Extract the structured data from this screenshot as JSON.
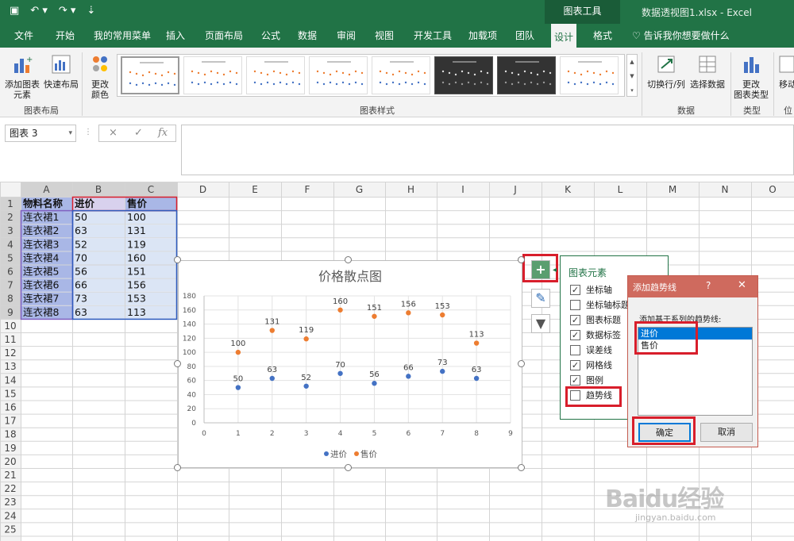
{
  "window": {
    "title": "数据透视图1.xlsx - Excel",
    "context_tab_group": "图表工具",
    "qat": {
      "save_icon": "save-icon",
      "undo_icon": "undo-icon",
      "redo_icon": "redo-icon"
    }
  },
  "tabs": [
    "文件",
    "开始",
    "我的常用菜单",
    "插入",
    "页面布局",
    "公式",
    "数据",
    "审阅",
    "视图",
    "开发工具",
    "加载项",
    "团队",
    "设计",
    "格式"
  ],
  "active_tab": "设计",
  "tell_me": "告诉我你想要做什么",
  "ribbon": {
    "add_element": "添加图表\n元素",
    "quick_layout": "快速布局",
    "change_color": "更改\n颜色",
    "group_layout": "图表布局",
    "group_styles": "图表样式",
    "switch_row_col": "切换行/列",
    "select_data": "选择数据",
    "group_data": "数据",
    "change_type": "更改\n图表类型",
    "group_type": "类型",
    "move": "移动",
    "group_location": "位"
  },
  "formula_bar": {
    "name_box": "图表 3",
    "cancel": "×",
    "enter": "✓",
    "fx": "fx",
    "formula": ""
  },
  "sheet": {
    "columns": [
      "A",
      "B",
      "C",
      "D",
      "E",
      "F",
      "G",
      "H",
      "I",
      "J",
      "K",
      "L",
      "M",
      "N",
      "O"
    ],
    "rows": [
      [
        "物料名称",
        "进价",
        "售价"
      ],
      [
        "连衣裙1",
        "50",
        "100"
      ],
      [
        "连衣裙2",
        "63",
        "131"
      ],
      [
        "连衣裙3",
        "52",
        "119"
      ],
      [
        "连衣裙4",
        "70",
        "160"
      ],
      [
        "连衣裙5",
        "56",
        "151"
      ],
      [
        "连衣裙6",
        "66",
        "156"
      ],
      [
        "连衣裙7",
        "73",
        "153"
      ],
      [
        "连衣裙8",
        "63",
        "113"
      ]
    ],
    "row_count": 25
  },
  "chart_data": {
    "type": "scatter",
    "title": "价格散点图",
    "xlim": [
      0,
      9
    ],
    "ylim": [
      0,
      180
    ],
    "x_ticks": [
      0,
      1,
      2,
      3,
      4,
      5,
      6,
      7,
      8,
      9
    ],
    "y_ticks": [
      0,
      20,
      40,
      60,
      80,
      100,
      120,
      140,
      160,
      180
    ],
    "grid": true,
    "legend": "bottom",
    "series": [
      {
        "name": "进价",
        "color": "#4472c4",
        "x": [
          1,
          2,
          3,
          4,
          5,
          6,
          7,
          8
        ],
        "y": [
          50,
          63,
          52,
          70,
          56,
          66,
          73,
          63
        ]
      },
      {
        "name": "售价",
        "color": "#ed7d31",
        "x": [
          1,
          2,
          3,
          4,
          5,
          6,
          7,
          8
        ],
        "y": [
          100,
          131,
          119,
          160,
          151,
          156,
          153,
          113
        ]
      }
    ]
  },
  "chart_elements_panel": {
    "title": "图表元素",
    "items": [
      {
        "label": "坐标轴",
        "checked": true
      },
      {
        "label": "坐标轴标题",
        "checked": false
      },
      {
        "label": "图表标题",
        "checked": true
      },
      {
        "label": "数据标签",
        "checked": true
      },
      {
        "label": "误差线",
        "checked": false
      },
      {
        "label": "网格线",
        "checked": true
      },
      {
        "label": "图例",
        "checked": true
      },
      {
        "label": "趋势线",
        "checked": false
      }
    ]
  },
  "dialog": {
    "title": "添加趋势线",
    "help": "?",
    "close": "✕",
    "prompt": "添加基于系列的趋势线:",
    "options": [
      "进价",
      "售价"
    ],
    "selected": "进价",
    "ok": "确定",
    "cancel": "取消"
  },
  "watermark": {
    "text": "Baidu经验",
    "url": "jingyan.baidu.com"
  },
  "colors": {
    "excel_green": "#217346",
    "highlight_red": "#d81e2b",
    "selection_blue": "#0078d7"
  }
}
